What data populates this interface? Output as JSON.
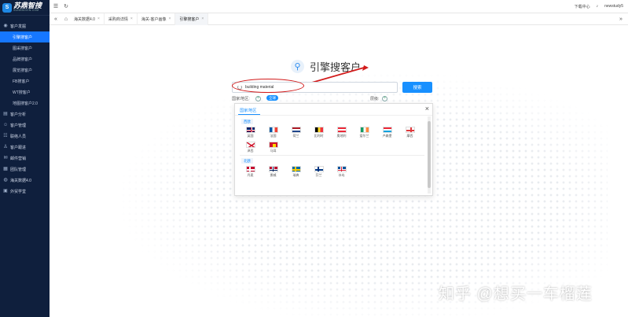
{
  "brand": {
    "name": "苏鼎智搜",
    "sub": "SUNEBOXIN.COM"
  },
  "sidebar": {
    "group_active": "客户发掘",
    "sub_items": [
      {
        "label": "引擎搜客户",
        "active": true
      },
      {
        "label": "图采搜客户"
      },
      {
        "label": "品牌搜客户"
      },
      {
        "label": "展览搜客户"
      },
      {
        "label": "FB搜客户"
      },
      {
        "label": "WT搜客户"
      },
      {
        "label": "地图搜客户2.0"
      }
    ],
    "groups": [
      {
        "label": "客户分析",
        "icon": "chart-icon"
      },
      {
        "label": "客户管理",
        "icon": "user-icon"
      },
      {
        "label": "联络人员",
        "icon": "contact-icon"
      },
      {
        "label": "客户跟进",
        "icon": "follow-icon"
      },
      {
        "label": "邮件营销",
        "icon": "mail-icon"
      },
      {
        "label": "团队管理",
        "icon": "team-icon"
      },
      {
        "label": "海关数据4.0",
        "icon": "globe-icon"
      },
      {
        "label": "外贸学堂",
        "icon": "school-icon"
      }
    ]
  },
  "topbar": {
    "help": "下载中心",
    "user": "newstudy5"
  },
  "tabs": [
    {
      "label": "海关数据4.0"
    },
    {
      "label": "采购商详情"
    },
    {
      "label": "海关-客户画像"
    },
    {
      "label": "引擎搜客户",
      "active": true
    }
  ],
  "page": {
    "title": "引擎搜客户",
    "search_value": "building material",
    "search_button": "搜索",
    "region_label": "国家/地区:",
    "chip_label": "全球",
    "level_label": "层级:"
  },
  "popup": {
    "tab": "国家/地区",
    "regions": [
      {
        "name": "西欧",
        "countries": [
          "英国",
          "法国",
          "荷兰",
          "比利时",
          "奥地利",
          "爱尔兰",
          "卢森堡",
          "摩西",
          "泽西",
          "马耳"
        ]
      },
      {
        "name": "北欧",
        "countries": [
          "丹麦",
          "挪威",
          "瑞典",
          "芬兰",
          "冰岛"
        ]
      }
    ]
  },
  "watermark": "知乎 @想买一车榴莲",
  "colors": {
    "sidebar_bg": "#0f1f3d",
    "accent": "#1890ff",
    "annotation": "#d21b1b"
  }
}
